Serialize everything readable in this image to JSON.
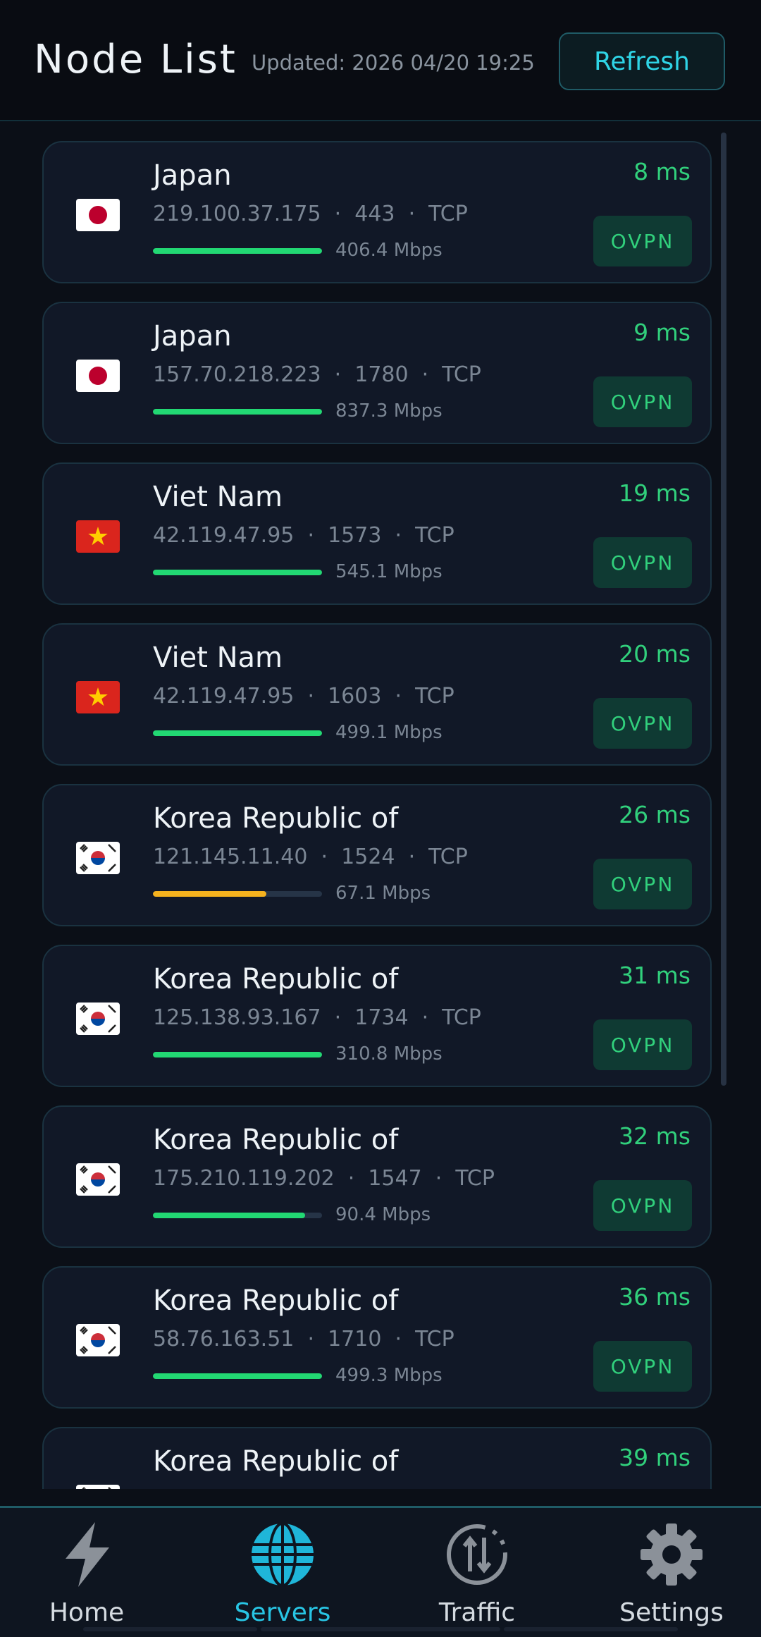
{
  "header": {
    "title": "Node List",
    "updated": "Updated: 2026 04/20 19:25",
    "refresh_label": "Refresh"
  },
  "colors": {
    "good": "#22d873",
    "fair": "#f5b21e",
    "accent": "#2fd4e6"
  },
  "nodes": [
    {
      "country": "Japan",
      "flag": "jp",
      "meta": "219.100.37.175  ·  443  ·  TCP",
      "speed": "406.4 Mbps",
      "ping": "8 ms",
      "protocol": "OVPN",
      "quality": 1.0,
      "level": "good"
    },
    {
      "country": "Japan",
      "flag": "jp",
      "meta": "157.70.218.223  ·  1780  ·  TCP",
      "speed": "837.3 Mbps",
      "ping": "9 ms",
      "protocol": "OVPN",
      "quality": 1.0,
      "level": "good"
    },
    {
      "country": "Viet Nam",
      "flag": "vn",
      "meta": "42.119.47.95  ·  1573  ·  TCP",
      "speed": "545.1 Mbps",
      "ping": "19 ms",
      "protocol": "OVPN",
      "quality": 1.0,
      "level": "good"
    },
    {
      "country": "Viet Nam",
      "flag": "vn",
      "meta": "42.119.47.95  ·  1603  ·  TCP",
      "speed": "499.1 Mbps",
      "ping": "20 ms",
      "protocol": "OVPN",
      "quality": 1.0,
      "level": "good"
    },
    {
      "country": "Korea Republic of",
      "flag": "kr",
      "meta": "121.145.11.40  ·  1524  ·  TCP",
      "speed": "67.1 Mbps",
      "ping": "26 ms",
      "protocol": "OVPN",
      "quality": 0.67,
      "level": "fair"
    },
    {
      "country": "Korea Republic of",
      "flag": "kr",
      "meta": "125.138.93.167  ·  1734  ·  TCP",
      "speed": "310.8 Mbps",
      "ping": "31 ms",
      "protocol": "OVPN",
      "quality": 1.0,
      "level": "good"
    },
    {
      "country": "Korea Republic of",
      "flag": "kr",
      "meta": "175.210.119.202  ·  1547  ·  TCP",
      "speed": "90.4 Mbps",
      "ping": "32 ms",
      "protocol": "OVPN",
      "quality": 0.9,
      "level": "good"
    },
    {
      "country": "Korea Republic of",
      "flag": "kr",
      "meta": "58.76.163.51  ·  1710  ·  TCP",
      "speed": "499.3 Mbps",
      "ping": "36 ms",
      "protocol": "OVPN",
      "quality": 1.0,
      "level": "good"
    },
    {
      "country": "Korea Republic of",
      "flag": "kr",
      "meta": "",
      "speed": "",
      "ping": "39 ms",
      "protocol": "",
      "quality": 0,
      "level": "good"
    }
  ],
  "nav": [
    {
      "label": "Home",
      "icon": "lightning-icon",
      "active": false
    },
    {
      "label": "Servers",
      "icon": "globe-icon",
      "active": true
    },
    {
      "label": "Traffic",
      "icon": "traffic-icon",
      "active": false
    },
    {
      "label": "Settings",
      "icon": "gear-icon",
      "active": false
    }
  ]
}
